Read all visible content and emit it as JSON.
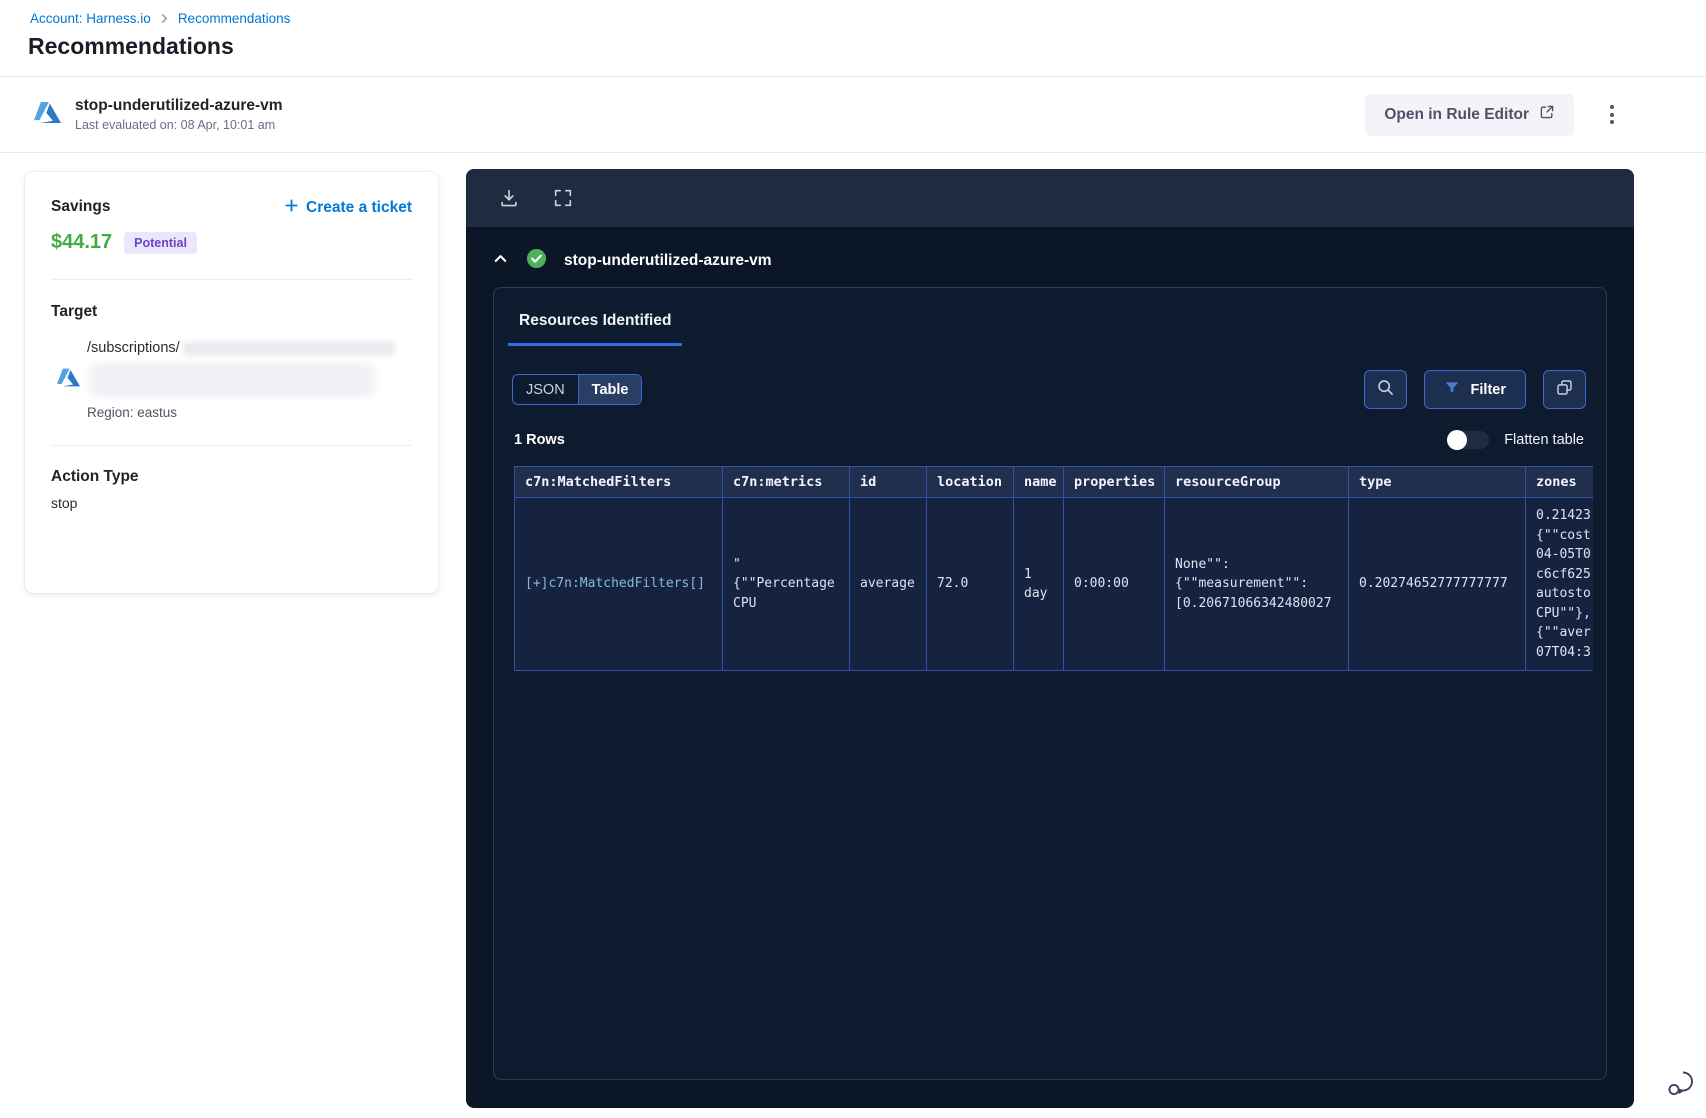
{
  "breadcrumb": {
    "account_link": "Account: Harness.io",
    "current": "Recommendations"
  },
  "page_title": "Recommendations",
  "rule_header": {
    "name": "stop-underutilized-azure-vm",
    "last_evaluated": "Last evaluated on: 08 Apr, 10:01 am",
    "open_in_rule_editor_label": "Open in Rule Editor"
  },
  "savings_card": {
    "savings_label": "Savings",
    "amount": "$44.17",
    "badge_label": "Potential",
    "create_ticket_label": "Create a ticket",
    "target_label": "Target",
    "target_path": "/subscriptions/",
    "region": "Region: eastus",
    "action_type_label": "Action Type",
    "action_type_value": "stop"
  },
  "results_panel": {
    "rule_title": "stop-underutilized-azure-vm",
    "tab_label": "Resources Identified",
    "view_options": {
      "json": "JSON",
      "table": "Table",
      "selected": "Table"
    },
    "filter_label": "Filter",
    "rows_count": "1 Rows",
    "flatten_table_label": "Flatten table",
    "flatten_table_on": false,
    "table": {
      "columns": [
        "c7n:MatchedFilters",
        "c7n:metrics",
        "id",
        "location",
        "name",
        "properties",
        "resourceGroup",
        "type",
        "zones"
      ],
      "rows": [
        [
          "[+]c7n:MatchedFilters[]",
          "\"\n{\"\"Percentage CPU",
          "average",
          "72.0",
          "1 day",
          "0:00:00",
          "None\"\":\n{\"\"measurement\"\":\n[0.20671066342480027",
          "0.20274652777777777",
          "0.21423\n{\"\"cost\n04-05T0\nc6cf625\nautosto\nCPU\"\"},\n{\"\"aver\n07T04:3"
        ]
      ]
    }
  },
  "icons": {
    "azure-logo": "azure triangle mark",
    "plus-icon": "+",
    "external-link-icon": "box with arrow",
    "kebab-menu-icon": "vertical three dots",
    "download-icon": "arrow into tray",
    "fullscreen-icon": "corner brackets",
    "collapse-chevron-icon": "chevron up",
    "success-check-icon": "green circle check",
    "search-icon": "magnifier",
    "filter-icon": "funnel",
    "copy-icon": "overlapping squares",
    "chat-support-icon": "speech bubbles"
  },
  "colors": {
    "accent_blue": "#0278d5",
    "savings_green": "#42ab45",
    "badge_bg": "#eae6fb",
    "badge_text": "#6c44c4",
    "panel_bg": "#0b1727",
    "panel_toolbar_bg": "#1e2b40",
    "inner_card_bg": "#0e1b2e",
    "table_border": "#2d54a3",
    "table_header_bg": "#202f4d",
    "table_cell_bg": "#152340",
    "tab_underline": "#2e6ee0",
    "button_border_blue": "#3f66c9",
    "success_green": "#4db15b",
    "matched_filters_link": "#85b7e2"
  }
}
